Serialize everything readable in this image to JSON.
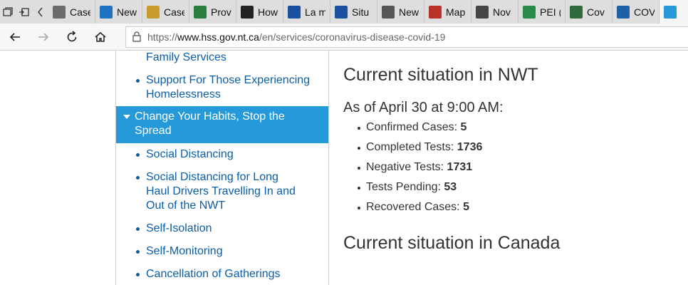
{
  "tabs": [
    {
      "label": "Case",
      "icon": "document-icon",
      "color": "#6b6b6b"
    },
    {
      "label": "New",
      "icon": "chart-icon",
      "color": "#1d73c2"
    },
    {
      "label": "Case",
      "icon": "document-icon",
      "color": "#c79b2c"
    },
    {
      "label": "Prov",
      "icon": "flag-icon",
      "color": "#2a7d3c"
    },
    {
      "label": "How",
      "icon": "shield-icon",
      "color": "#222222"
    },
    {
      "label": "La m",
      "icon": "fleur-de-lis-icon",
      "color": "#1b4fa0"
    },
    {
      "label": "Situ",
      "icon": "fleur-de-lis-icon",
      "color": "#1b4fa0"
    },
    {
      "label": "New",
      "icon": "grid-icon",
      "color": "#555555"
    },
    {
      "label": "Map",
      "icon": "map-pin-icon",
      "color": "#b8322a"
    },
    {
      "label": "Nov",
      "icon": "envelope-icon",
      "color": "#444444"
    },
    {
      "label": "PEI (",
      "icon": "pei-icon",
      "color": "#2b8a4a"
    },
    {
      "label": "Cov",
      "icon": "globe-icon",
      "color": "#2f6b3a"
    },
    {
      "label": "COV",
      "icon": "government-icon",
      "color": "#1f5fa8"
    },
    {
      "label": "",
      "icon": "nwt-icon",
      "color": "#2699d8"
    }
  ],
  "address": {
    "protocol": "https://",
    "host": "www.hss.gov.nt.ca",
    "path": "/en/services/coronavirus-disease-covid-19"
  },
  "sidebar": {
    "items_before": [
      {
        "label": "Family Services"
      },
      {
        "label": "Support For Those Experiencing Homelessness"
      }
    ],
    "active": {
      "label": "Change Your Habits, Stop the Spread"
    },
    "items_after": [
      {
        "label": "Social Distancing"
      },
      {
        "label": "Social Distancing for Long Haul Drivers Travelling In and Out of the NWT"
      },
      {
        "label": "Self-Isolation"
      },
      {
        "label": "Self-Monitoring"
      },
      {
        "label": "Cancellation of Gatherings"
      }
    ]
  },
  "main": {
    "heading_nwt": "Current situation in NWT",
    "as_of": "As of April 30 at 9:00 AM:",
    "stats": [
      {
        "label": "Confirmed Cases:",
        "value": "5"
      },
      {
        "label": "Completed Tests:",
        "value": "1736"
      },
      {
        "label": "Negative Tests:",
        "value": "1731"
      },
      {
        "label": "Tests Pending:",
        "value": "53"
      },
      {
        "label": "Recovered Cases:",
        "value": "5"
      }
    ],
    "heading_canada": "Current situation in Canada"
  }
}
